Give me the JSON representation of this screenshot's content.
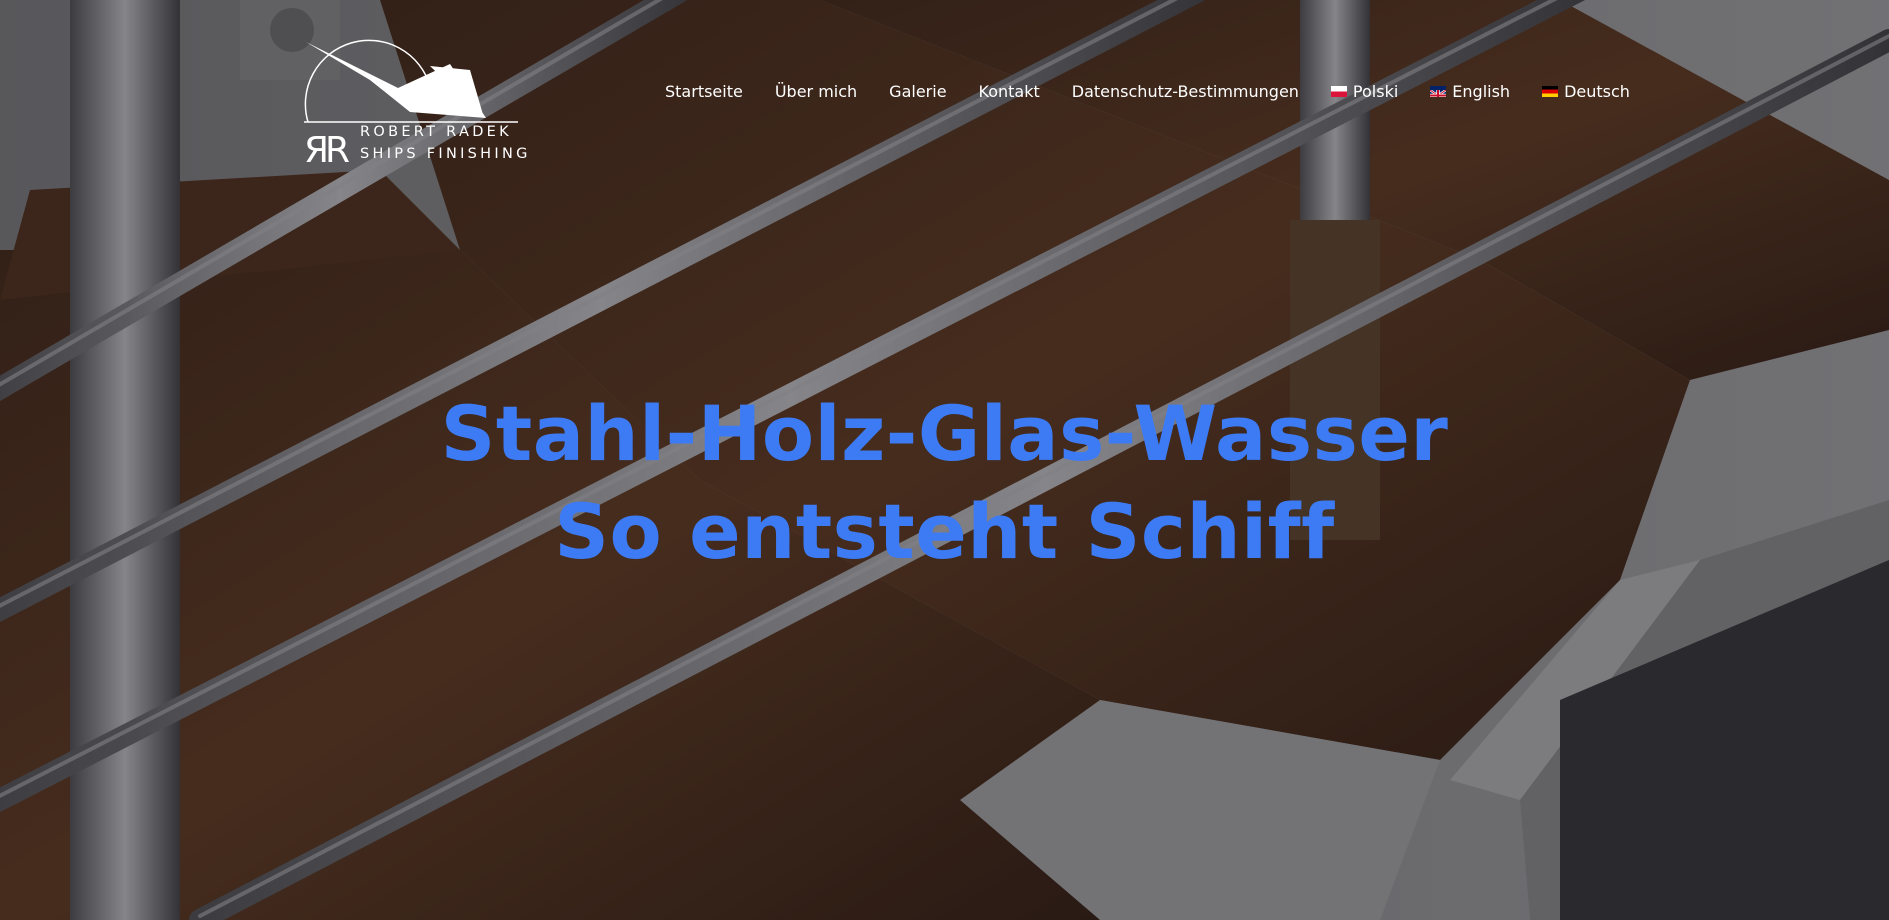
{
  "logo": {
    "line1": "ROBERT RADEK",
    "line2": "SHIPS FINISHING",
    "monogram": "RR"
  },
  "nav": {
    "items": [
      {
        "label": "Startseite"
      },
      {
        "label": "Über mich"
      },
      {
        "label": "Galerie"
      },
      {
        "label": "Kontakt"
      },
      {
        "label": "Datenschutz-Bestimmungen"
      },
      {
        "label": "Polski",
        "flag": "flag-pl-icon"
      },
      {
        "label": "English",
        "flag": "flag-gb-icon"
      },
      {
        "label": "Deutsch",
        "flag": "flag-de-icon"
      }
    ]
  },
  "hero": {
    "line1": "Stahl-Holz-Glas-Wasser",
    "line2": "So entsteht Schiff"
  },
  "colors": {
    "headline": "#3d7bf5",
    "nav_text": "#ffffff"
  }
}
